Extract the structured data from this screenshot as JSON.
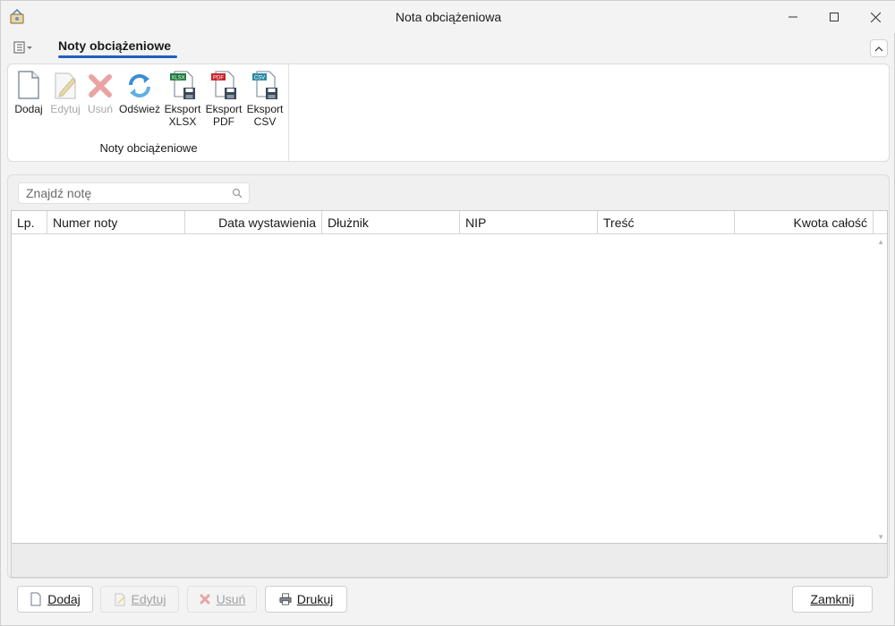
{
  "window": {
    "title": "Nota obciążeniowa",
    "controls": {
      "minimize": "—",
      "maximize": "☐",
      "close": "✕"
    }
  },
  "ribbon": {
    "tab_active": "Noty obciążeniowe",
    "collapse_icon": "chevron-up-icon",
    "group_label": "Noty obciążeniowe",
    "buttons": [
      {
        "label": "Dodaj",
        "icon": "new-document-icon",
        "enabled": true
      },
      {
        "label": "Edytuj",
        "icon": "edit-document-icon",
        "enabled": false
      },
      {
        "label": "Usuń",
        "icon": "delete-icon",
        "enabled": false
      },
      {
        "label": "Odśwież",
        "icon": "refresh-icon",
        "enabled": true
      },
      {
        "label": "Eksport\nXLSX",
        "line1": "Eksport",
        "line2": "XLSX",
        "badge": "XLSX",
        "icon": "export-xlsx-icon",
        "enabled": true
      },
      {
        "label": "Eksport\nPDF",
        "line1": "Eksport",
        "line2": "PDF",
        "badge": "PDF",
        "icon": "export-pdf-icon",
        "enabled": true
      },
      {
        "label": "Eksport\nCSV",
        "line1": "Eksport",
        "line2": "CSV",
        "badge": "CSV",
        "icon": "export-csv-icon",
        "enabled": true
      }
    ]
  },
  "search": {
    "placeholder": "Znajdź notę",
    "value": ""
  },
  "table": {
    "columns": [
      "Lp.",
      "Numer noty",
      "Data wystawienia",
      "Dłużnik",
      "NIP",
      "Treść",
      "Kwota całość"
    ],
    "rows": []
  },
  "footer_buttons": {
    "add": {
      "label": "Dodaj",
      "enabled": true
    },
    "edit": {
      "label": "Edytuj",
      "enabled": false
    },
    "delete": {
      "label": "Usuń",
      "enabled": false
    },
    "print": {
      "label": "Drukuj",
      "enabled": true
    },
    "close": {
      "label": "Zamknij",
      "enabled": true
    }
  },
  "colors": {
    "accent": "#1f5fbf",
    "delete_red": "#e05050",
    "xlsx_green": "#1e7a3c",
    "pdf_red": "#c8252c",
    "csv_teal": "#2a8aa6"
  }
}
